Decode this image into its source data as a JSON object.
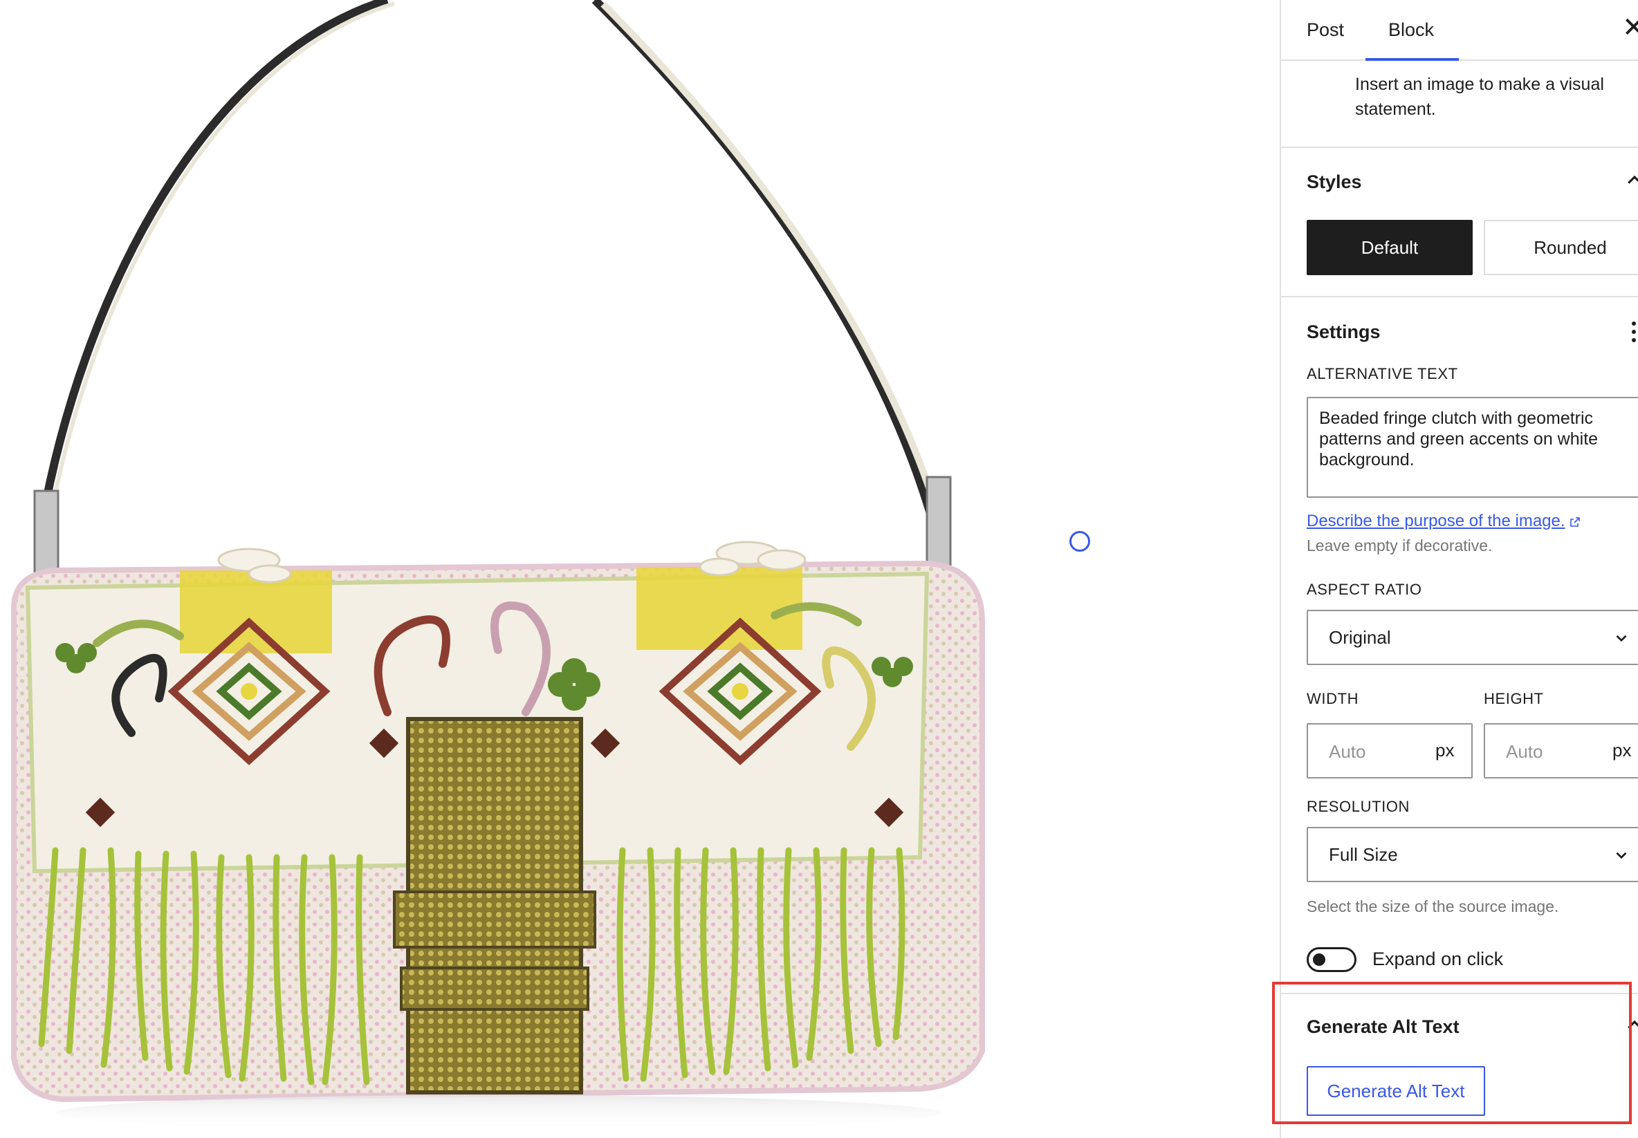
{
  "tabs": {
    "post": "Post",
    "block": "Block"
  },
  "block_description": "Insert an image to make a visual statement.",
  "styles": {
    "title": "Styles",
    "options": [
      "Default",
      "Rounded"
    ],
    "selected": "Default"
  },
  "settings": {
    "title": "Settings",
    "alt_text_label": "ALTERNATIVE TEXT",
    "alt_text_value": "Beaded fringe clutch with geometric patterns and green accents on white background.",
    "alt_link": "Describe the purpose of the image.",
    "alt_help": "Leave empty if decorative.",
    "aspect_ratio_label": "ASPECT RATIO",
    "aspect_ratio_value": "Original",
    "width_label": "WIDTH",
    "width_placeholder": "Auto",
    "width_unit": "px",
    "height_label": "HEIGHT",
    "height_placeholder": "Auto",
    "height_unit": "px",
    "resolution_label": "RESOLUTION",
    "resolution_value": "Full Size",
    "resolution_help": "Select the size of the source image.",
    "expand_label": "Expand on click",
    "expand_on": false
  },
  "generate": {
    "title": "Generate Alt Text",
    "button": "Generate Alt Text"
  },
  "colors": {
    "accent": "#3858e9",
    "dark": "#1e1e1e",
    "highlight": "#e53935"
  },
  "icons": [
    "close-icon",
    "chevron-up-icon",
    "kebab-menu-icon",
    "external-link-icon",
    "chevron-down-icon"
  ]
}
